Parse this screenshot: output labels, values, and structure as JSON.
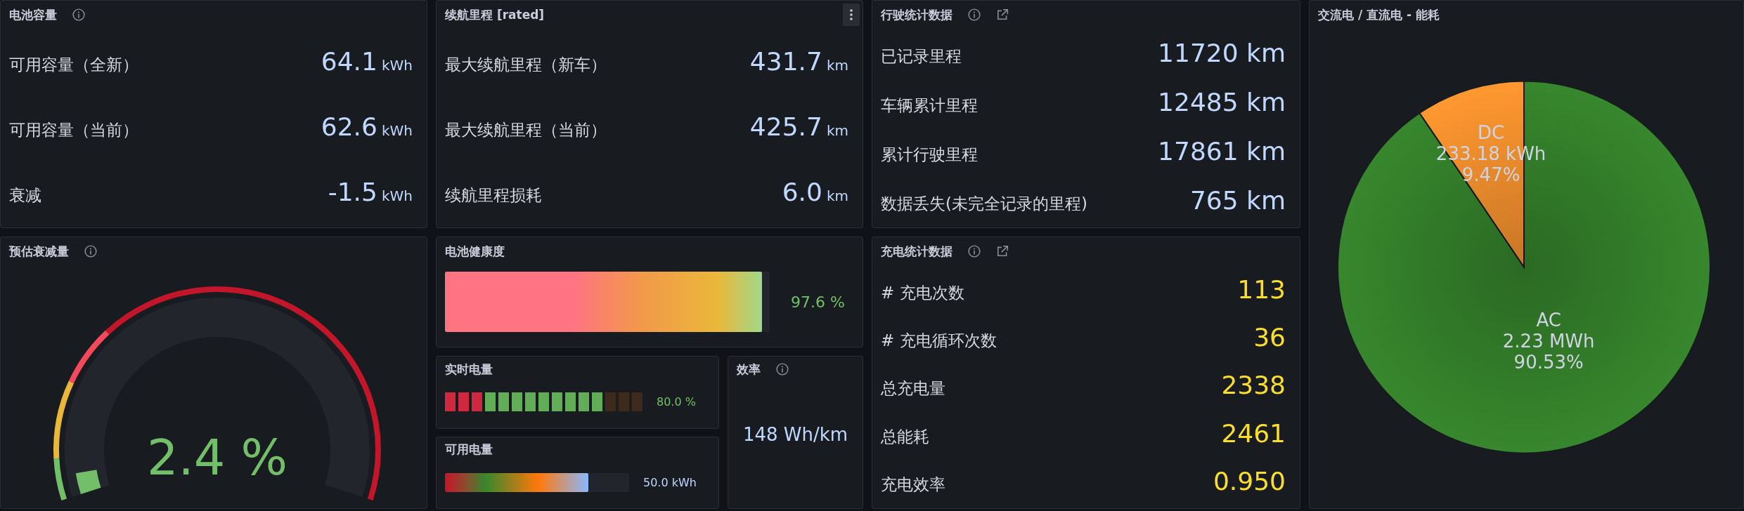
{
  "battery_capacity": {
    "title": "电池容量",
    "rows": [
      {
        "label": "可用容量（全新）",
        "value": "64.1",
        "unit": "kWh"
      },
      {
        "label": "可用容量（当前）",
        "value": "62.6",
        "unit": "kWh"
      },
      {
        "label": "衰减",
        "value": "-1.5",
        "unit": "kWh"
      }
    ]
  },
  "range": {
    "title": "续航里程 [rated]",
    "rows": [
      {
        "label": "最大续航里程（新车）",
        "value": "431.7",
        "unit": "km"
      },
      {
        "label": "最大续航里程（当前）",
        "value": "425.7",
        "unit": "km"
      },
      {
        "label": "续航里程损耗",
        "value": "6.0",
        "unit": "km"
      }
    ]
  },
  "driving_stats": {
    "title": "行驶统计数据",
    "rows": [
      {
        "label": "已记录里程",
        "value": "11720 km"
      },
      {
        "label": "车辆累计里程",
        "value": "12485 km"
      },
      {
        "label": "累计行驶里程",
        "value": "17861 km"
      },
      {
        "label": "数据丢失(未完全记录的里程)",
        "value": "765 km"
      }
    ]
  },
  "ac_dc": {
    "title": "交流电 / 直流电 - 能耗",
    "slices": [
      {
        "amount": "2.23 MWh",
        "share": "90.53%",
        "color": "#37872d"
      },
      {
        "amount": "233.18 kWh",
        "share": "9.47%",
        "color": "#ff9830"
      }
    ],
    "chart_data": {
      "type": "pie",
      "categories": [
        "AC",
        "DC"
      ],
      "values": [
        90.53,
        9.47
      ]
    }
  },
  "degradation": {
    "title": "预估衰减量",
    "value": "2.4 %",
    "level": 0.04
  },
  "health": {
    "title": "电池健康度",
    "level": 0.976,
    "reading": "97.6 %"
  },
  "charge_level": {
    "title": "实时电量",
    "level": 0.8,
    "reading": "80.0 %"
  },
  "usable_energy": {
    "title": "可用电量",
    "level": 0.78,
    "reading": "50.0 kWh"
  },
  "efficiency": {
    "title": "效率",
    "value": "148 Wh/km"
  },
  "charging_stats": {
    "title": "充电统计数据",
    "rows": [
      {
        "label": "# 充电次数",
        "value": "113"
      },
      {
        "label": "# 充电循环次数",
        "value": "36"
      },
      {
        "label": "总充电量",
        "value": "2338"
      },
      {
        "label": "总能耗",
        "value": "2461"
      },
      {
        "label": "充电效率",
        "value": "0.950"
      }
    ]
  }
}
